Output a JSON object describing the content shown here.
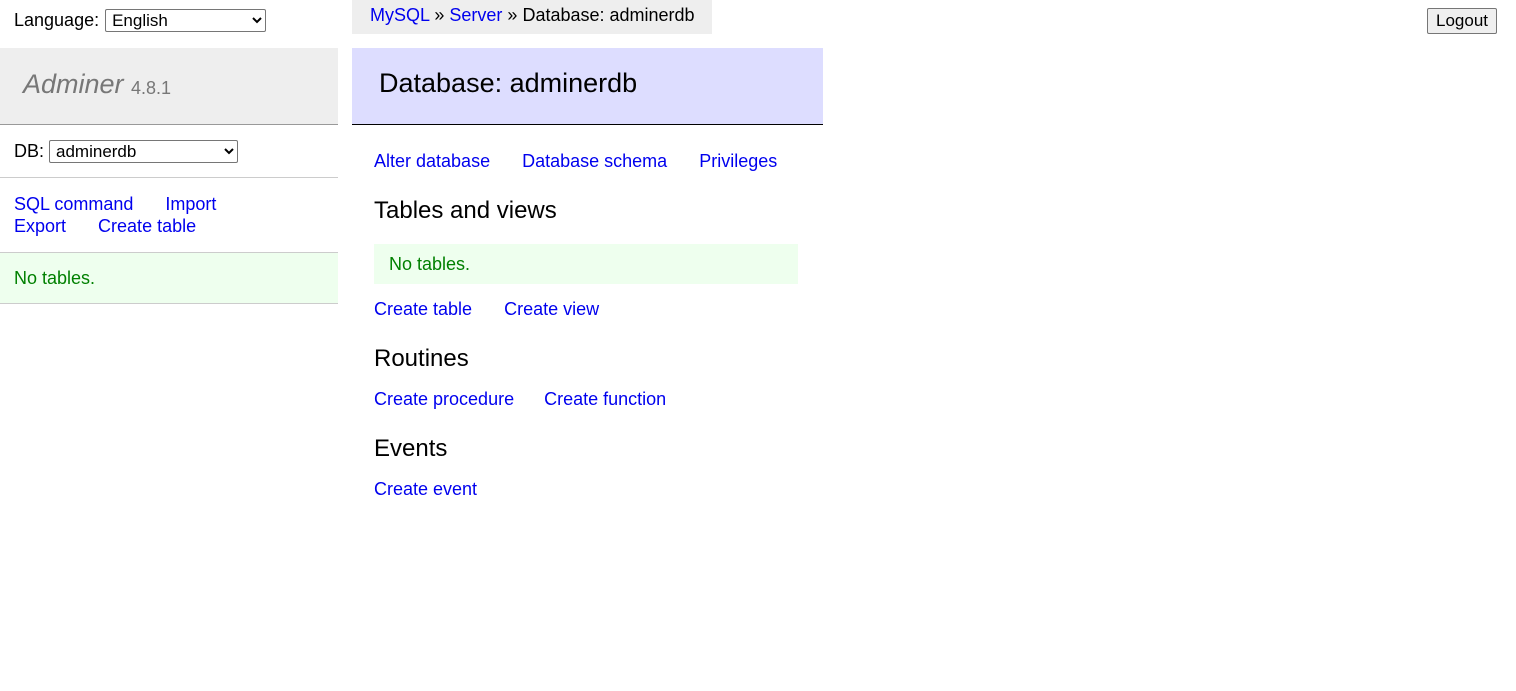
{
  "language": {
    "label": "Language:",
    "selected": "English"
  },
  "brand": {
    "name": "Adminer",
    "version": "4.8.1"
  },
  "db": {
    "label": "DB:",
    "selected": "adminerdb"
  },
  "sidebar": {
    "links": [
      {
        "label": "SQL command"
      },
      {
        "label": "Import"
      },
      {
        "label": "Export"
      },
      {
        "label": "Create table"
      }
    ],
    "message": "No tables."
  },
  "breadcrumb": {
    "mysql": "MySQL",
    "sep": "»",
    "server": "Server",
    "current": "Database: adminerdb"
  },
  "logout_label": "Logout",
  "main": {
    "title": "Database: adminerdb",
    "top_links": [
      {
        "label": "Alter database"
      },
      {
        "label": "Database schema"
      },
      {
        "label": "Privileges"
      }
    ],
    "tables": {
      "heading": "Tables and views",
      "message": "No tables.",
      "links": [
        {
          "label": "Create table"
        },
        {
          "label": "Create view"
        }
      ]
    },
    "routines": {
      "heading": "Routines",
      "links": [
        {
          "label": "Create procedure"
        },
        {
          "label": "Create function"
        }
      ]
    },
    "events": {
      "heading": "Events",
      "links": [
        {
          "label": "Create event"
        }
      ]
    }
  }
}
